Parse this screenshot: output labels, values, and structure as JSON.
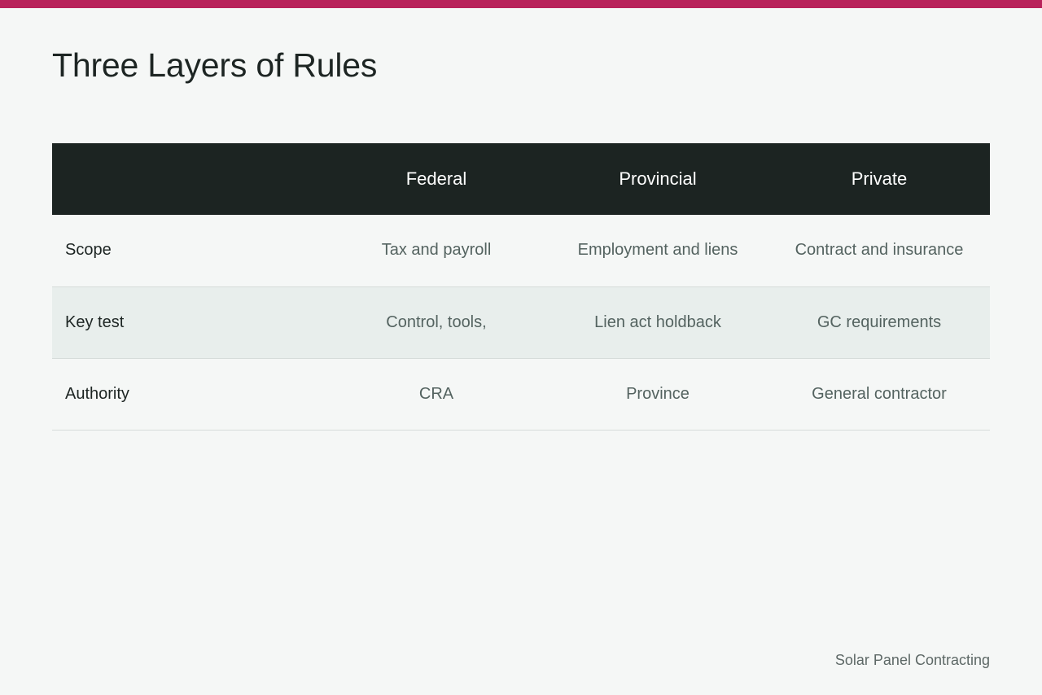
{
  "colors": {
    "accent_bar": "#b8225a",
    "header_background": "#1c2422"
  },
  "page": {
    "title": "Three Layers of Rules"
  },
  "table": {
    "columns": [
      "",
      "Federal",
      "Provincial",
      "Private"
    ],
    "rows": [
      {
        "label": "Scope",
        "values": [
          "Tax and payroll",
          "Employment and liens",
          "Contract and insurance"
        ]
      },
      {
        "label": "Key test",
        "values": [
          "Control, tools,",
          "Lien act holdback",
          "GC requirements"
        ]
      },
      {
        "label": "Authority",
        "values": [
          "CRA",
          "Province",
          "General contractor"
        ]
      }
    ]
  },
  "footer": {
    "text": "Solar Panel Contracting"
  }
}
